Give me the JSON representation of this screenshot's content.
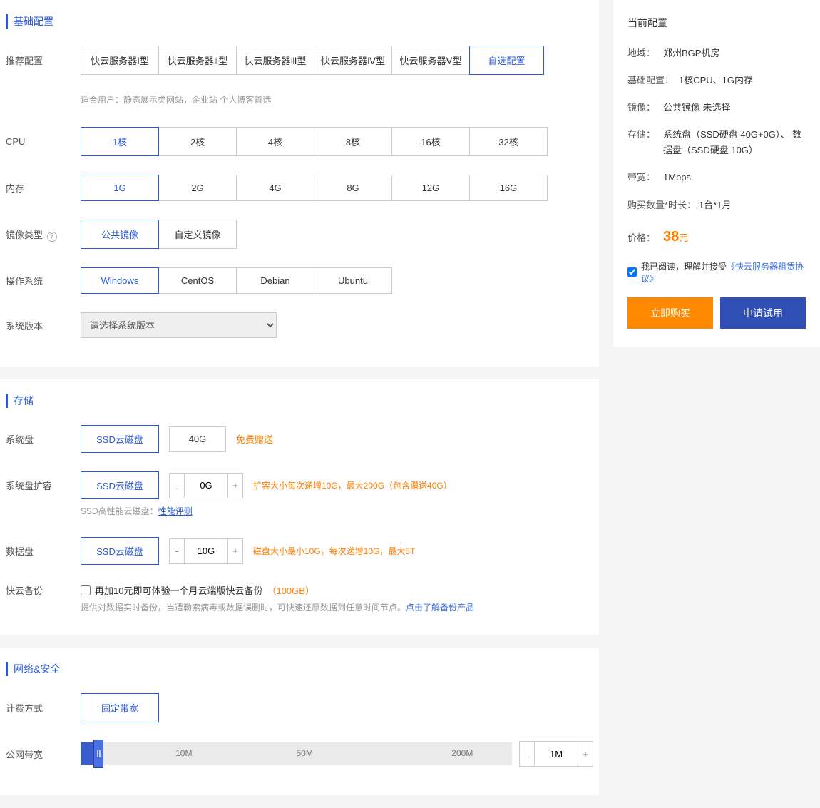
{
  "sections": {
    "basic": "基础配置",
    "storage": "存储",
    "network": "网络&安全"
  },
  "recommend": {
    "label": "推荐配置",
    "options": [
      "快云服务器Ⅰ型",
      "快云服务器Ⅱ型",
      "快云服务器Ⅲ型",
      "快云服务器Ⅳ型",
      "快云服务器Ⅴ型"
    ],
    "custom": "自选配置",
    "hint": "适合用户：静态展示类网站，企业站 个人博客首选"
  },
  "cpu": {
    "label": "CPU",
    "options": [
      "1核",
      "2核",
      "4核",
      "8核",
      "16核",
      "32核"
    ],
    "selected": "1核"
  },
  "mem": {
    "label": "内存",
    "options": [
      "1G",
      "2G",
      "4G",
      "8G",
      "12G",
      "16G"
    ],
    "selected": "1G"
  },
  "imgtype": {
    "label": "镜像类型",
    "help": "?",
    "options": [
      "公共镜像",
      "自定义镜像"
    ],
    "selected": "公共镜像"
  },
  "os": {
    "label": "操作系统",
    "options": [
      "Windows",
      "CentOS",
      "Debian",
      "Ubuntu"
    ],
    "selected": "Windows"
  },
  "ver": {
    "label": "系统版本",
    "placeholder": "请选择系统版本"
  },
  "sysdisk": {
    "label": "系统盘",
    "type": "SSD云磁盘",
    "size": "40G",
    "free": "免费赠送"
  },
  "sysdisk_ext": {
    "label": "系统盘扩容",
    "type": "SSD云磁盘",
    "value": "0G",
    "note": "扩容大小每次递增10G，最大200G（包含赠送40G）",
    "perf_label": "SSD高性能云磁盘：",
    "perf_link": "性能评测"
  },
  "datadisk": {
    "label": "数据盘",
    "type": "SSD云磁盘",
    "value": "10G",
    "note": "磁盘大小最小10G，每次递增10G，最大5T"
  },
  "backup": {
    "label": "快云备份",
    "chk_text": "再加10元即可体验一个月云端版快云备份",
    "chk_suffix": "（100GB）",
    "desc_pre": "提供对数据实时备份，当遭勒索病毒或数据误删时，可快速还原数据到任意时间节点。",
    "desc_link": "点击了解备份产品"
  },
  "billing": {
    "label": "计费方式",
    "option": "固定带宽"
  },
  "bandwidth": {
    "label": "公网带宽",
    "ticks": [
      "10M",
      "50M",
      "200M"
    ],
    "value": "1M"
  },
  "stepper": {
    "minus": "-",
    "plus": "+"
  },
  "side": {
    "title": "当前配置",
    "region_k": "地域：",
    "region_v": "郑州BGP机房",
    "basic_k": "基础配置：",
    "basic_v": "1核CPU、1G内存",
    "image_k": "镜像：",
    "image_v": "公共镜像 未选择",
    "storage_k": "存储：",
    "storage_v": "系统盘（SSD硬盘 40G+0G）、 数据盘（SSD硬盘 10G）",
    "bw_k": "带宽：",
    "bw_v": "1Mbps",
    "qty_k": "购买数量*时长：",
    "qty_v": "1台*1月",
    "price_k": "价格：",
    "price_v": "38",
    "price_unit": "元",
    "agree_pre": "我已阅读，理解并接受",
    "agree_link": "《快云服务器租赁协议》",
    "buy": "立即购买",
    "try": "申请试用"
  }
}
